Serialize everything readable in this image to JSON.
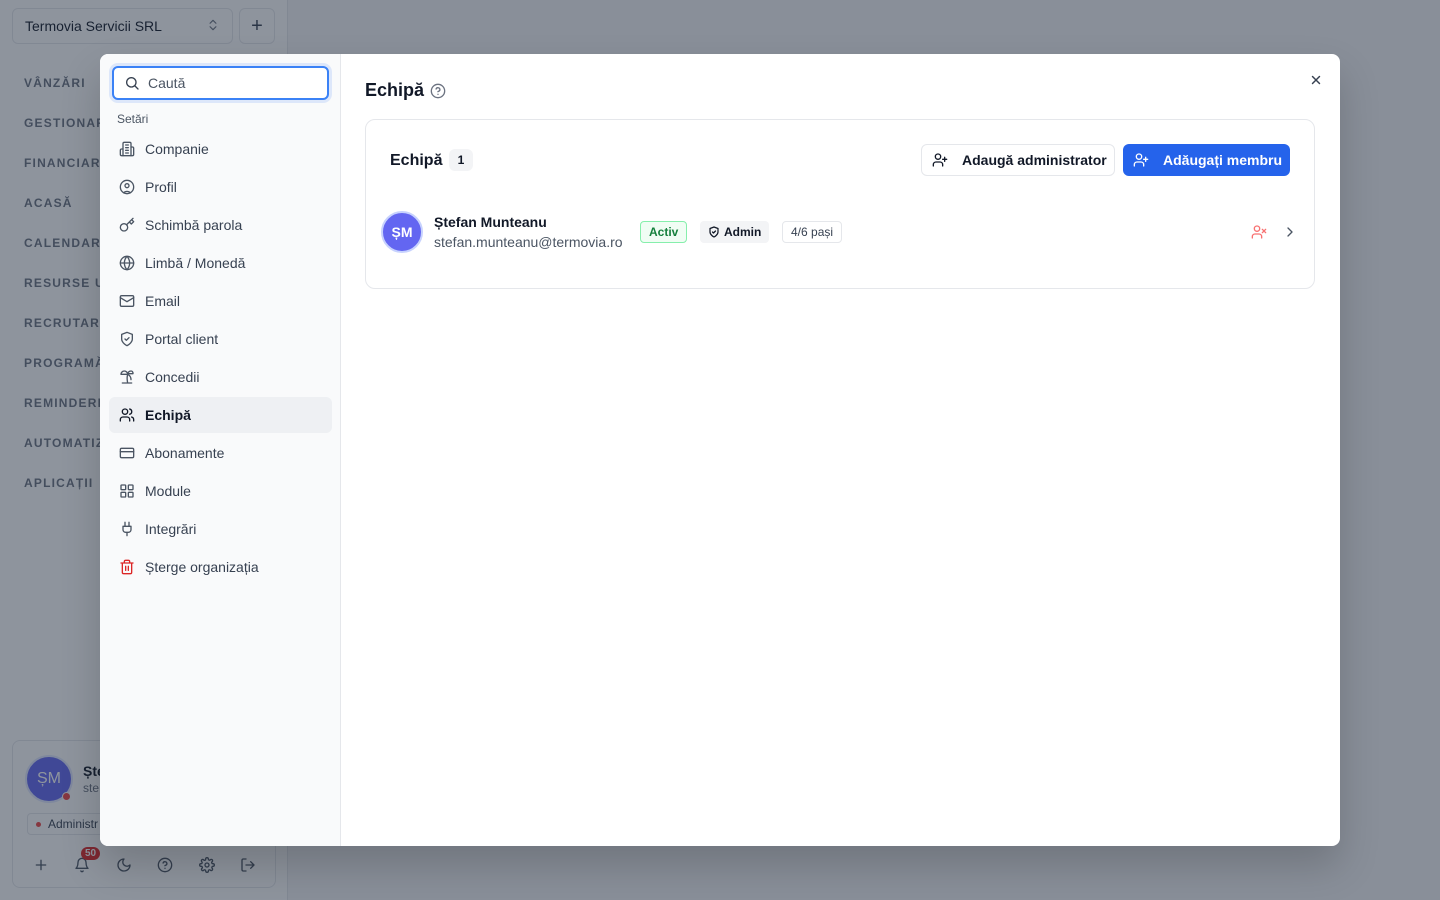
{
  "org": {
    "name": "Termovia Servicii SRL",
    "add_label": "+"
  },
  "sidebar_groups": [
    "VÂNZĂRI",
    "GESTIONAR",
    "FINANCIAR",
    "ACASĂ",
    "CALENDARU",
    "RESURSE UI",
    "RECRUTARE",
    "PROGRAMĂ",
    "REMINDERE",
    "AUTOMATIZ",
    "APLICAȚII"
  ],
  "user_card": {
    "initials": "ȘM",
    "name": "Ște",
    "email": "ste",
    "role": "Administr",
    "notifications": "50"
  },
  "settings": {
    "search_placeholder": "Caută",
    "section_label": "Setări",
    "items": [
      {
        "label": "Companie",
        "icon": "building-icon"
      },
      {
        "label": "Profil",
        "icon": "user-circle-icon"
      },
      {
        "label": "Schimbă parola",
        "icon": "key-icon"
      },
      {
        "label": "Limbă / Monedă",
        "icon": "globe-icon"
      },
      {
        "label": "Email",
        "icon": "mail-icon"
      },
      {
        "label": "Portal client",
        "icon": "shield-icon"
      },
      {
        "label": "Concedii",
        "icon": "palm-tree-icon"
      },
      {
        "label": "Echipă",
        "icon": "users-icon"
      },
      {
        "label": "Abonamente",
        "icon": "credit-card-icon"
      },
      {
        "label": "Module",
        "icon": "grid-icon"
      },
      {
        "label": "Integrări",
        "icon": "plug-icon"
      },
      {
        "label": "Șterge organizația",
        "icon": "trash-icon"
      }
    ],
    "active_item": "Echipă"
  },
  "page": {
    "title": "Echipă"
  },
  "team": {
    "title": "Echipă",
    "count": "1",
    "add_admin_label": "Adaugă administrator",
    "add_member_label": "Adăugați membru",
    "members": [
      {
        "initials": "ȘM",
        "name": "Ștefan Munteanu",
        "email": "stefan.munteanu@termovia.ro",
        "status": "Activ",
        "role": "Admin",
        "steps": "4/6 pași"
      }
    ]
  },
  "colors": {
    "primary": "#2563eb",
    "avatar": "#6366f1",
    "active_badge": "#15803d",
    "danger": "#dc2626"
  }
}
